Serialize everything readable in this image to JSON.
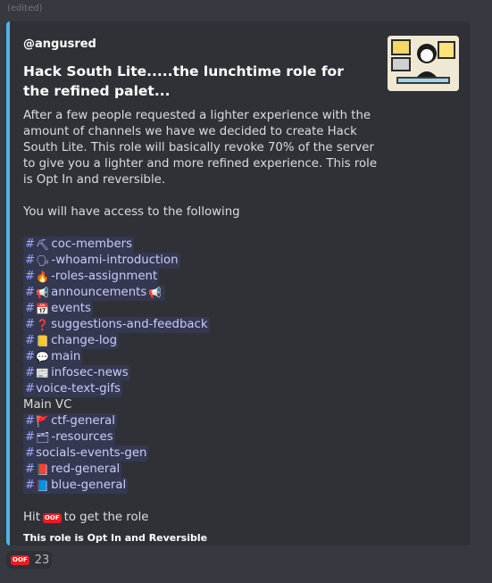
{
  "message": {
    "edited_label": "(edited)"
  },
  "embed": {
    "accent_color": "#4fb3e5",
    "author": "@angusred",
    "title": "Hack South Lite.....the lunchtime role for the refined palet...",
    "paragraph1": "After a few people requested a lighter experience with the amount of channels we have we decided to create Hack South Lite. This role will basically revoke 70% of the server to give you a lighter and more refined experience. This role is Opt In and reversible.",
    "paragraph2": "You will have access to the following",
    "channels": [
      {
        "hash": "#",
        "icon": "hammer-icon",
        "glyph": "⛏",
        "name": "coc-members"
      },
      {
        "hash": "#",
        "icon": "speaking-head-icon",
        "glyph": "🗣",
        "name": "-whoami-introduction"
      },
      {
        "hash": "#",
        "icon": "fire-icon",
        "glyph": "🔥",
        "name": "-roles-assignment"
      },
      {
        "hash": "#",
        "icon": "megaphone-icon",
        "glyph": "📢",
        "name": "announcements",
        "trailing_glyph": "📢"
      },
      {
        "hash": "#",
        "icon": "calendar-icon",
        "glyph": "📅",
        "name": "events"
      },
      {
        "hash": "#",
        "icon": "question-icon",
        "glyph": "❓",
        "name": "suggestions-and-feedback"
      },
      {
        "hash": "#",
        "icon": "notepad-icon",
        "glyph": "📒",
        "name": "change-log"
      },
      {
        "hash": "#",
        "icon": "speech-bubble-icon",
        "glyph": "💬",
        "name": "main"
      },
      {
        "hash": "#",
        "icon": "newspaper-icon",
        "glyph": "📰",
        "name": "infosec-news"
      },
      {
        "hash": "#",
        "icon": "",
        "glyph": "",
        "name": "voice-text-gifs"
      },
      {
        "plain": "Main VC"
      },
      {
        "hash": "#",
        "icon": "red-flag-icon",
        "glyph": "🚩",
        "name": "ctf-general"
      },
      {
        "hash": "#",
        "icon": "card-index-icon",
        "glyph": "🗂",
        "name": "-resources"
      },
      {
        "hash": "#",
        "icon": "",
        "glyph": "",
        "name": "socials-events-gen"
      },
      {
        "hash": "#",
        "icon": "red-book-icon",
        "glyph": "📕",
        "name": "red-general"
      },
      {
        "hash": "#",
        "icon": "blue-book-icon",
        "glyph": "📘",
        "name": "blue-general"
      }
    ],
    "hit_prefix": "Hit",
    "hit_suffix": "to get the role",
    "oof_label": "OOF",
    "footer_note": "This role is Opt In and Reversible"
  },
  "reaction": {
    "emoji_label": "OOF",
    "count": "23"
  }
}
